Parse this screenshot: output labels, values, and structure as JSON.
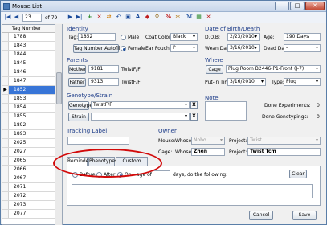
{
  "window": {
    "title": "Mouse List"
  },
  "nav": {
    "record": "23",
    "of": "of 79"
  },
  "grid": {
    "header": "Tag Number",
    "rows": [
      "1788",
      "1843",
      "1844",
      "1845",
      "1846",
      "1847",
      "1852",
      "1853",
      "1854",
      "1855",
      "1892",
      "1893",
      "2025",
      "2027",
      "2065",
      "2066",
      "2067",
      "2071",
      "2072",
      "2073",
      "2077"
    ],
    "selected_index": 6
  },
  "identity": {
    "title": "Identity",
    "tag_label": "Tag:",
    "tag_value": "1852",
    "male_label": "Male",
    "female_label": "Female",
    "coat_label": "Coat Color:",
    "coat_value": "Black",
    "autofill_label": "Tag Number Autofill",
    "ear_label": "Ear Pouch:",
    "ear_value": "P"
  },
  "dob": {
    "title": "Date of Birth/Death",
    "dob_label": "D.O.B:",
    "dob_value": "2/23/2010",
    "age_label": "Age:",
    "age_value": "190 Days",
    "wean_label": "Wean Date:",
    "wean_value": "3/16/2010",
    "dead_label": "Dead Date:",
    "dead_value": "-"
  },
  "parents": {
    "title": "Parents",
    "mother_label": "Mother",
    "mother_id": "9181",
    "mother_strain": "TwistF/F",
    "father_label": "Father",
    "father_id": "9313",
    "father_strain": "TwistF/F"
  },
  "where": {
    "title": "Where",
    "cage_label": "Cage",
    "cage_value": "Plug Room B2446-P1-Front   (J-7)",
    "putin_label": "Put-in Time:",
    "putin_value": "3/16/2010",
    "type_label": "Type:",
    "type_value": "Plug"
  },
  "genotype": {
    "title": "Genotype/Strain",
    "genotype_label": "Genotype",
    "genotype_value": "TwistF/F",
    "strain_label": "Strain",
    "x": "X"
  },
  "note": {
    "title": "Note",
    "done_exp_label": "Done Experiments:",
    "done_exp_value": "0",
    "done_geno_label": "Done Genotypings:",
    "done_geno_value": "0"
  },
  "tracking": {
    "title": "Tracking Label"
  },
  "owner": {
    "title": "Owner",
    "mouse_label": "Mouse:",
    "whose_label": "Whose:",
    "mouse_whose": "Nobo",
    "project_label": "Project:",
    "mouse_project": "Twist",
    "cage_label": "Cage:",
    "cage_whose": "Zhen",
    "cage_project": "Twist Tcm"
  },
  "tabs": [
    "Reminder",
    "Phenotypes",
    "Custom Fields"
  ],
  "reminder": {
    "before": "Before",
    "after": "After",
    "on": "On",
    "age_of": "age of",
    "days_text": "days, do the following:",
    "clear": "Clear"
  },
  "footer": {
    "cancel": "Cancel",
    "save": "Save"
  }
}
